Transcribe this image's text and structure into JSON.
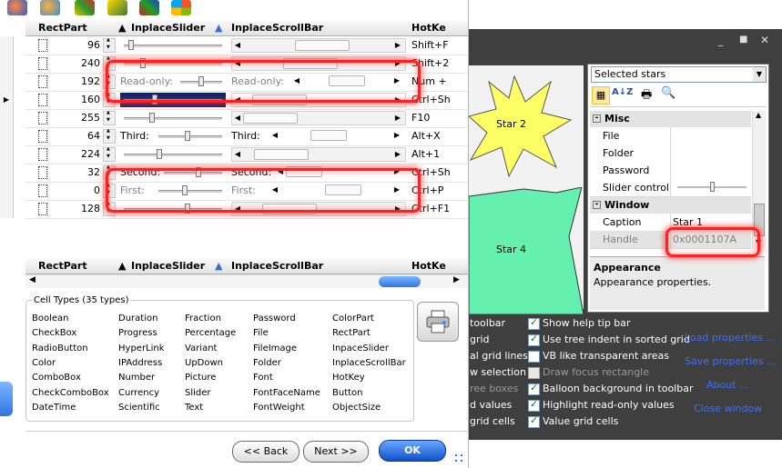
{
  "grid": {
    "headers": {
      "rectpart": "RectPart",
      "inplace_slider": "InplaceSlider",
      "inplace_scrollbar": "InplaceScrollBar",
      "hotkey": "HotKe"
    },
    "rows": [
      {
        "value": "96",
        "slider_label": "",
        "scroll_label": "",
        "hotkey": "Shift+F",
        "slider_pos": 0.05,
        "scroll_pos": 0.55
      },
      {
        "value": "240",
        "slider_label": "",
        "scroll_label": "",
        "hotkey": "Shift+2",
        "slider_pos": 0.18,
        "scroll_pos": 0.42
      },
      {
        "value": "192",
        "slider_label": "Read-only:",
        "scroll_label": "Read-only:",
        "hotkey": "Num +",
        "slider_pos": 0.5,
        "scroll_pos": 0.5
      },
      {
        "value": "160",
        "slider_label": "",
        "scroll_label": "",
        "hotkey": "Ctrl+Sh",
        "slider_pos": 0.3,
        "scroll_pos": 0.1
      },
      {
        "value": "255",
        "slider_label": "",
        "scroll_label": "",
        "hotkey": "F10",
        "slider_pos": 0.27,
        "scroll_pos": 0.0
      },
      {
        "value": "64",
        "slider_label": "Third:",
        "scroll_label": "Third:",
        "hotkey": "Alt+X",
        "slider_pos": 0.45,
        "scroll_pos": 0.4
      },
      {
        "value": "224",
        "slider_label": "",
        "scroll_label": "",
        "hotkey": "Alt+1",
        "slider_pos": 0.35,
        "scroll_pos": 0.12
      },
      {
        "value": "32",
        "slider_label": "Second:",
        "scroll_label": "Second:",
        "hotkey": "Ctrl+Sh",
        "slider_pos": 0.6,
        "scroll_pos": 0.0
      },
      {
        "value": "0",
        "slider_label": "First:",
        "scroll_label": "First:",
        "hotkey": "Ctrl+P",
        "slider_pos": 0.4,
        "scroll_pos": 0.6
      },
      {
        "value": "128",
        "slider_label": "",
        "scroll_label": "",
        "hotkey": "Ctrl+F1",
        "slider_pos": 0.66,
        "scroll_pos": 0.2
      }
    ]
  },
  "grid2_headers": {
    "rectpart": "RectPart",
    "inplace_slider": "InplaceSlider",
    "inplace_scrollbar": "InplaceScrollBar",
    "hotkey": "HotKe"
  },
  "cell_types": {
    "title": "Cell Types (35 types)",
    "columns": [
      [
        "Boolean",
        "CheckBox",
        "RadioButton",
        "Color",
        "ComboBox",
        "CheckComboBox",
        "DateTime"
      ],
      [
        "Duration",
        "Progress",
        "HyperLink",
        "IPAddress",
        "Number",
        "Currency",
        "Scientific"
      ],
      [
        "Fraction",
        "Percentage",
        "Variant",
        "UpDown",
        "Picture",
        "Slider",
        "Text"
      ],
      [
        "Password",
        "File",
        "FileImage",
        "Folder",
        "Font",
        "FontFaceName",
        "FontWeight"
      ],
      [
        "ColorPart",
        "RectPart",
        "InpaceSlider",
        "InplaceScrollBar",
        "HotKey",
        "Button",
        "ObjectSize"
      ]
    ]
  },
  "buttons": {
    "back": "<< Back",
    "next": "Next >>",
    "ok": "OK"
  },
  "canvas": {
    "star2": "Star 2",
    "star4": "Star 4"
  },
  "property_grid": {
    "combo_value": "Selected stars",
    "categories": {
      "misc": "Misc",
      "window": "Window"
    },
    "misc_rows": [
      {
        "key": "File",
        "value": ""
      },
      {
        "key": "Folder",
        "value": ""
      },
      {
        "key": "Password",
        "value": ""
      },
      {
        "key": "Slider control",
        "value": ""
      }
    ],
    "window_rows": [
      {
        "key": "Caption",
        "value": "Star 1"
      },
      {
        "key": "Handle",
        "value": "0x0001107A"
      }
    ],
    "description_title": "Appearance",
    "description_text": "Appearance properties."
  },
  "options": [
    {
      "label": "Show help tip bar",
      "checked": true,
      "disabled": false
    },
    {
      "label": "Use tree indent in sorted grid",
      "checked": true,
      "disabled": false
    },
    {
      "label": "VB like transparent areas",
      "checked": false,
      "disabled": false
    },
    {
      "label": "Draw focus rectangle",
      "checked": false,
      "disabled": true
    },
    {
      "label": "Balloon background in toolbar",
      "checked": true,
      "disabled": false
    },
    {
      "label": "Highlight read-only values",
      "checked": true,
      "disabled": false
    },
    {
      "label": "Value grid cells",
      "checked": true,
      "disabled": false
    }
  ],
  "options_left": [
    "toolbar",
    "grid",
    "al grid lines",
    "w selection",
    "ree boxes",
    "d values",
    "grid cells"
  ],
  "links": {
    "load": "Load properties ...",
    "save": "Save properties ...",
    "about": "About ...",
    "close": "Close window"
  },
  "colors": {
    "selection": "#0a246a",
    "highlight": "#ff2020",
    "star_yellow": "#ffff66",
    "star_green": "#66f0b0",
    "dark_panel": "#3f3f3f",
    "link": "#3a6fff"
  }
}
